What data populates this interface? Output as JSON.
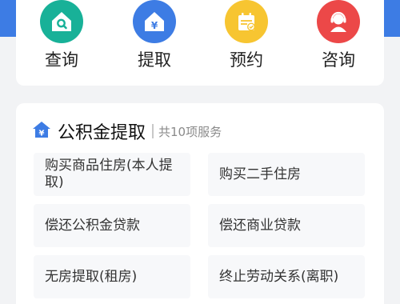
{
  "quick_actions": [
    {
      "label": "查询",
      "icon": "house-search-icon",
      "color": "#18b198"
    },
    {
      "label": "提取",
      "icon": "house-yuan-icon",
      "color": "#3d7ce4"
    },
    {
      "label": "预约",
      "icon": "calendar-check-icon",
      "color": "#f7c531"
    },
    {
      "label": "咨询",
      "icon": "customer-service-icon",
      "color": "#ec4848"
    }
  ],
  "section": {
    "title": "公积金提取",
    "subtitle": "共10项服务",
    "icon": "house-yuan-icon",
    "icon_color": "#3d7ce4"
  },
  "services": [
    "购买商品住房(本人提取)",
    "购买二手住房",
    "偿还公积金贷款",
    "偿还商业贷款",
    "无房提取(租房)",
    "终止劳动关系(离职)"
  ],
  "colors": {
    "header_blue": "#3d7ce4",
    "background": "#f2f3f5"
  }
}
